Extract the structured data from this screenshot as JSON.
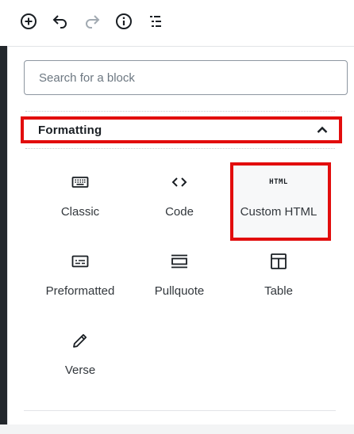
{
  "toolbar": {
    "buttons": [
      {
        "name": "add-block",
        "icon": "plus-circle-icon"
      },
      {
        "name": "undo",
        "icon": "undo-icon"
      },
      {
        "name": "redo",
        "icon": "redo-icon"
      },
      {
        "name": "info",
        "icon": "info-icon"
      },
      {
        "name": "outline",
        "icon": "list-outline-icon"
      }
    ]
  },
  "search": {
    "placeholder": "Search for a block",
    "value": ""
  },
  "category": {
    "label": "Formatting",
    "expanded": true,
    "chevron_icon": "chevron-up-icon"
  },
  "blocks": [
    {
      "label": "Classic",
      "icon": "keyboard-icon"
    },
    {
      "label": "Code",
      "icon": "code-brackets-icon"
    },
    {
      "label": "Custom HTML",
      "icon": "html-icon",
      "icon_text": "HTML",
      "highlighted": true
    },
    {
      "label": "Preformatted",
      "icon": "preformatted-icon"
    },
    {
      "label": "Pullquote",
      "icon": "pullquote-icon"
    },
    {
      "label": "Table",
      "icon": "table-icon"
    },
    {
      "label": "Verse",
      "icon": "pencil-icon"
    }
  ],
  "colors": {
    "highlight_border": "#e20d0d",
    "icon": "#191e23",
    "text": "#32373c",
    "disabled_icon": "#a2aab2"
  }
}
